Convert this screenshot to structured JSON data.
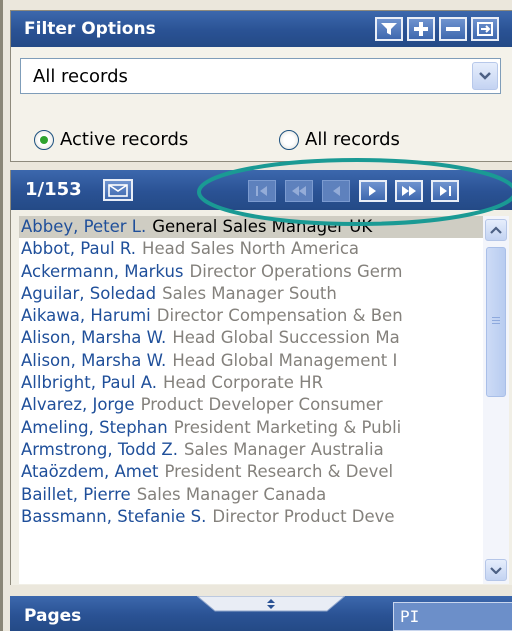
{
  "filter": {
    "title": "Filter Options",
    "select_value": "All records",
    "radio_active": "Active records",
    "radio_all": "All records",
    "selected_radio": "active"
  },
  "navigator": {
    "counter": "1/153",
    "records": [
      {
        "name": "Abbey, Peter L.",
        "title": "General Sales Manager UK",
        "selected": true
      },
      {
        "name": "Abbot, Paul R.",
        "title": "Head Sales North America"
      },
      {
        "name": "Ackermann, Markus",
        "title": "Director Operations Germ"
      },
      {
        "name": "Aguilar, Soledad",
        "title": "Sales Manager South"
      },
      {
        "name": "Aikawa, Harumi",
        "title": "Director Compensation & Ben"
      },
      {
        "name": "Alison, Marsha W.",
        "title": "Head Global Succession Ma"
      },
      {
        "name": "Alison, Marsha W.",
        "title": "Head Global Management I"
      },
      {
        "name": "Allbright, Paul A.",
        "title": "Head Corporate HR"
      },
      {
        "name": "Alvarez, Jorge",
        "title": "Product Developer Consumer"
      },
      {
        "name": "Ameling, Stephan",
        "title": "President Marketing & Publi"
      },
      {
        "name": "Armstrong, Todd Z.",
        "title": "Sales Manager Australia"
      },
      {
        "name": "Ataözdem, Amet",
        "title": "President Research & Devel"
      },
      {
        "name": "Baillet, Pierre",
        "title": "Sales Manager Canada"
      },
      {
        "name": "Bassmann, Stefanie S.",
        "title": "Director Product Deve"
      }
    ]
  },
  "pages": {
    "title": "Pages",
    "input_value": "PI"
  },
  "colors": {
    "header_blue": "#2a5294",
    "highlight_teal": "#1a9a94",
    "link_blue": "#1f4f9a"
  }
}
